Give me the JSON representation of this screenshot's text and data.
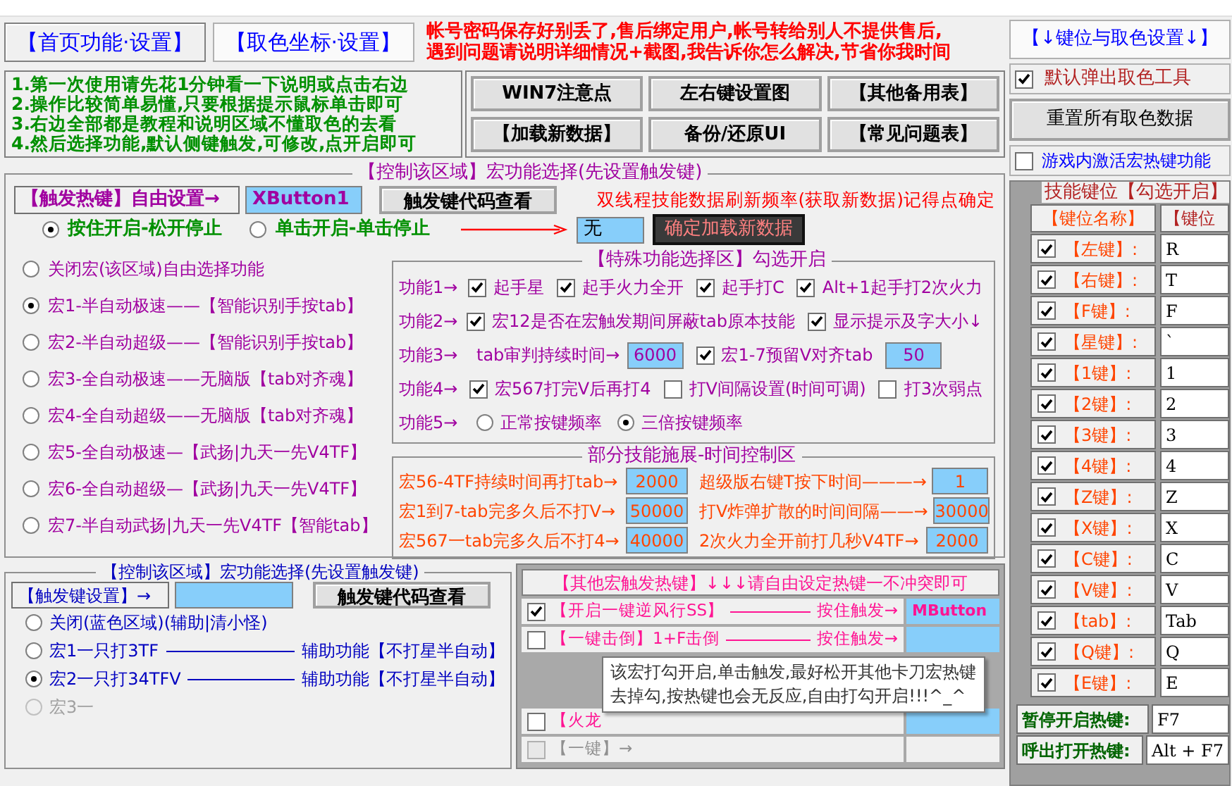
{
  "tabs": [
    {
      "label": "【首页功能·设置】",
      "selected": true
    },
    {
      "label": "【取色坐标·设置】",
      "selected": false
    }
  ],
  "notice": [
    "帐号密码保存好别丢了,售后绑定用户,帐号转给别人不提供售后,",
    "遇到问题请说明详细情况+截图,我告诉你怎么解决,节省你我时间"
  ],
  "instructions": [
    "1.第一次使用请先花1分钟看一下说明或点击右边",
    "2.操作比较简单易懂,只要根据提示鼠标单击即可",
    "3.右边全部都是教程和说明区域不懂取色的去看",
    "4.然后选择功能,默认侧键触发,可修改,点开启即可"
  ],
  "top_buttons": [
    "WIN7注意点",
    "左右键设置图",
    "【其他备用表】",
    "【加载新数据】",
    "备份/还原UI",
    "【常见问题表】"
  ],
  "macro_panel": {
    "title": "【控制该区域】宏功能选择(先设置触发键)",
    "trigger_label": "【触发热键】自由设置→",
    "trigger_value": "XButton1",
    "code_button": "触发键代码查看",
    "refresh_note": "双线程技能数据刷新频率(获取新数据)记得点确定",
    "refresh_value": "无",
    "load_button": "确定加载新数据",
    "modes": [
      {
        "label": "按住开启-松开停止",
        "selected": true
      },
      {
        "label": "单击开启-单击停止",
        "selected": false
      }
    ],
    "macros": [
      {
        "label": "关闭宏(该区域)自由选择功能",
        "selected": false
      },
      {
        "label": "宏1-半自动极速——【智能识别手按tab】",
        "selected": true
      },
      {
        "label": "宏2-半自动超级——【智能识别手按tab】",
        "selected": false
      },
      {
        "label": "宏3-全自动极速——无脑版【tab对齐魂】",
        "selected": false
      },
      {
        "label": "宏4-全自动超级——无脑版【tab对齐魂】",
        "selected": false
      },
      {
        "label": "宏5-全自动极速—【武扬|九天一先V4TF】",
        "selected": false
      },
      {
        "label": "宏6-全自动超级—【武扬|九天一先V4TF】",
        "selected": false
      },
      {
        "label": "宏7-半自动武扬|九天一先V4TF【智能tab】",
        "selected": false
      }
    ]
  },
  "special": {
    "title": "【特殊功能选择区】勾选开启",
    "rows": [
      {
        "label": "功能1→",
        "items": [
          {
            "kind": "checkbox",
            "label": "起手星",
            "checked": true
          },
          {
            "kind": "checkbox",
            "label": "起手火力全开",
            "checked": true
          },
          {
            "kind": "checkbox",
            "label": "起手打C",
            "checked": true
          },
          {
            "kind": "checkbox",
            "label": "Alt+1起手打2次火力",
            "checked": true
          }
        ]
      },
      {
        "label": "功能2→",
        "items": [
          {
            "kind": "checkbox",
            "label": "宏12是否在宏触发期间屏蔽tab原本技能",
            "checked": true
          },
          {
            "kind": "checkbox",
            "label": "显示提示及字大小↓",
            "checked": true
          }
        ]
      },
      {
        "label": "功能3→",
        "items": [
          {
            "kind": "text",
            "label": "tab审判持续时间→"
          },
          {
            "kind": "field",
            "value": "6000"
          },
          {
            "kind": "checkbox",
            "label": "宏1-7预留V对齐tab",
            "checked": true
          },
          {
            "kind": "field",
            "value": "50"
          }
        ]
      },
      {
        "label": "功能4→",
        "items": [
          {
            "kind": "checkbox",
            "label": "宏567打完V后再打4",
            "checked": true
          },
          {
            "kind": "checkbox",
            "label": "打V间隔设置(时间可调)",
            "checked": false
          },
          {
            "kind": "checkbox",
            "label": "打3次弱点",
            "checked": false
          }
        ]
      },
      {
        "label": "功能5→",
        "items": [
          {
            "kind": "radio",
            "label": "正常按键频率",
            "selected": false
          },
          {
            "kind": "radio",
            "label": "三倍按键频率",
            "selected": true
          }
        ]
      }
    ]
  },
  "timing": {
    "title": "部分技能施展-时间控制区",
    "items": [
      {
        "label": "宏56-4TF持续时间再打tab→",
        "value": "2000"
      },
      {
        "label": "超级版右键T按下时间———→",
        "value": "1"
      },
      {
        "label": "宏1到7-tab完多久后不打V→",
        "value": "50000"
      },
      {
        "label": "打V炸弹扩散的时间间隔——→",
        "value": "30000"
      },
      {
        "label": "宏567一tab完多久后不打4→",
        "value": "40000"
      },
      {
        "label": "2次火力全开前打几秒V4TF→",
        "value": "2000"
      }
    ]
  },
  "assist": {
    "title": "【控制该区域】宏功能选择(先设置触发键)",
    "trigger_label": "【触发键设置】→",
    "code_button": "触发键代码查看",
    "options": [
      {
        "label": "关闭(蓝色区域)(辅助|清小怪)",
        "selected": false,
        "disabled": false
      },
      {
        "label": "宏1一只打3TF",
        "suffix": "辅助功能【不打星半自动】",
        "selected": false,
        "disabled": false
      },
      {
        "label": "宏2一只打34TFV",
        "suffix": "辅助功能【不打星半自动】",
        "selected": true,
        "disabled": false
      },
      {
        "label": "宏3一",
        "selected": false,
        "disabled": true
      }
    ]
  },
  "other_hotkeys": {
    "title": "【其他宏触发热键】↓↓↓请自由设定热键一不冲突即可",
    "rows": [
      {
        "kind": "hotkey",
        "label": "【开启一键逆风行SS】",
        "action": "按住触发→",
        "value": "MButton",
        "checked": true,
        "disabled": false
      },
      {
        "kind": "hotkey",
        "label": "【一键击倒】1+F击倒",
        "action": "按住触发→",
        "checked": false,
        "disabled": false
      },
      {
        "kind": "covered"
      },
      {
        "kind": "hotkey",
        "label": "【火龙",
        "checked": false,
        "disabled": false
      },
      {
        "kind": "hotkey",
        "label": "【一键】→",
        "checked": false,
        "disabled": true
      }
    ]
  },
  "tooltip": [
    "该宏打勾开启,单击触发,最好松开其他卡刀宏热键",
    "去掉勾,按热键也会无反应,自由打勾开启!!!^_^"
  ],
  "key_header": "【↓键位与取色设置↓】",
  "popup_tool": {
    "label": "默认弹出取色工具",
    "checked": true
  },
  "reset_button": "重置所有取色数据",
  "hotkey_active": {
    "label": "游戏内激活宏热键功能",
    "checked": false
  },
  "key_table": {
    "title": "技能键位【勾选开启】",
    "columns": [
      "【键位名称】",
      "【键位"
    ],
    "rows": [
      {
        "name": "【左键】:",
        "key": "R",
        "checked": true
      },
      {
        "name": "【右键】:",
        "key": "T",
        "checked": true
      },
      {
        "name": "【F键】:",
        "key": "F",
        "checked": true
      },
      {
        "name": "【星键】:",
        "key": "`",
        "checked": true
      },
      {
        "name": "【1键】:",
        "key": "1",
        "checked": true
      },
      {
        "name": "【2键】:",
        "key": "2",
        "checked": true
      },
      {
        "name": "【3键】:",
        "key": "3",
        "checked": true
      },
      {
        "name": "【4键】:",
        "key": "4",
        "checked": true
      },
      {
        "name": "【Z键】:",
        "key": "Z",
        "checked": true
      },
      {
        "name": "【X键】:",
        "key": "X",
        "checked": true
      },
      {
        "name": "【C键】:",
        "key": "C",
        "checked": true
      },
      {
        "name": "【V键】:",
        "key": "V",
        "checked": true
      },
      {
        "name": "【tab】:",
        "key": "Tab",
        "checked": true
      },
      {
        "name": "【Q键】:",
        "key": "Q",
        "checked": true
      },
      {
        "name": "【E键】:",
        "key": "E",
        "checked": true
      }
    ],
    "hotkeys": [
      {
        "label": "暂停开启热键:",
        "value": "F7"
      },
      {
        "label": "呼出打开热键:",
        "value": "Alt + F7"
      }
    ]
  }
}
